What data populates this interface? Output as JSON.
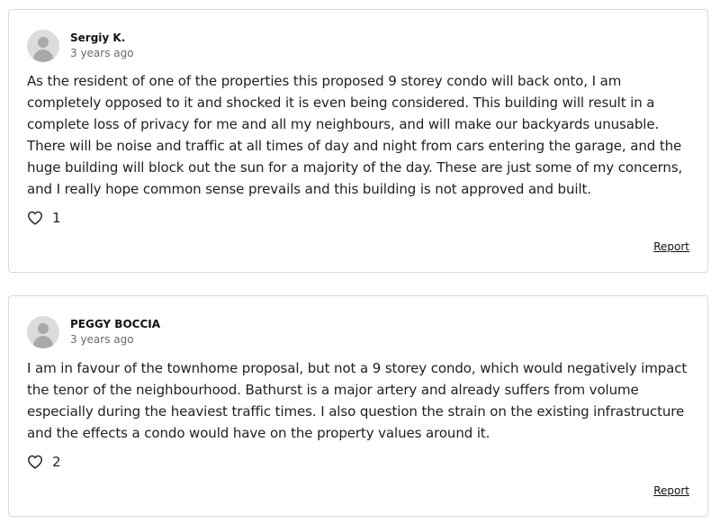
{
  "comments": [
    {
      "author": "Sergiy K.",
      "timestamp": "3 years ago",
      "text": "As the resident of one of the properties this proposed 9 storey condo will back onto, I am completely opposed to it and shocked it is even being considered. This building will result in a complete loss of privacy for me and all my neighbours, and will make our backyards unusable. There will be noise and traffic at all times of day and night from cars entering the garage, and the huge building will block out the sun for a majority of the day. These are just some of my concerns, and I really hope common sense prevails and this building is not approved and built.",
      "likes": "1",
      "report_label": "Report",
      "avatar_icon": "user-avatar-icon",
      "like_icon": "heart-icon"
    },
    {
      "author": "PEGGY BOCCIA",
      "timestamp": "3 years ago",
      "text": "I am in favour of the townhome proposal, but not a 9 storey condo, which would negatively impact the tenor of the neighbourhood. Bathurst is a major artery and already suffers from volume especially during the heaviest traffic times. I also question the strain on the existing infrastructure and the effects a condo would have on the property values around it.",
      "likes": "2",
      "report_label": "Report",
      "avatar_icon": "user-avatar-icon",
      "like_icon": "heart-icon"
    }
  ],
  "colors": {
    "border": "#d9d9d9",
    "avatar_bg": "#dcdcdc",
    "avatar_fg": "#a9a9a9",
    "text": "#1f1f1f",
    "muted": "#6b6b6b"
  }
}
